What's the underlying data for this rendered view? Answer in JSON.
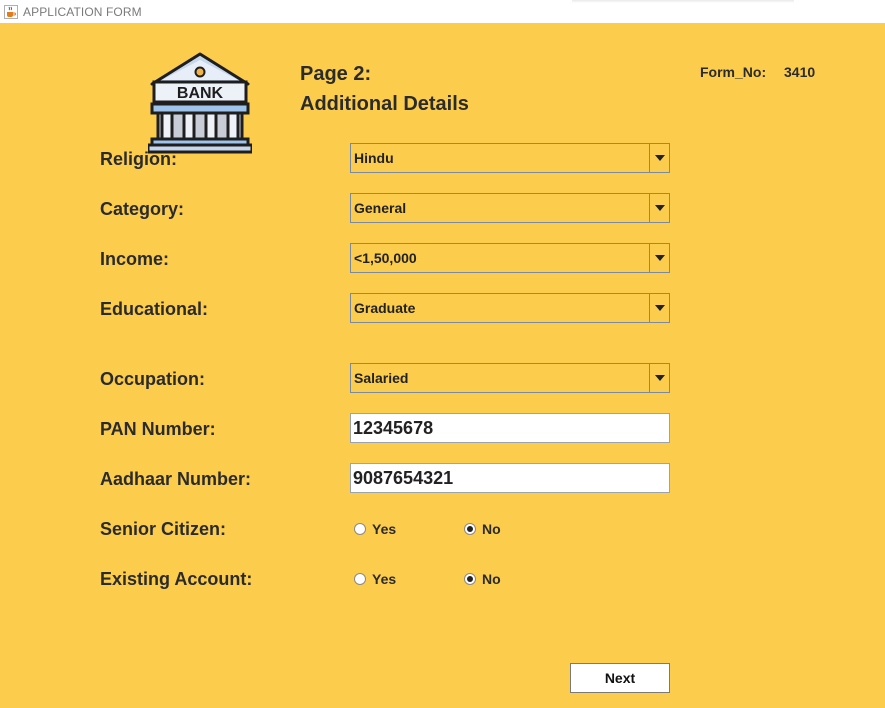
{
  "window": {
    "title": "APPLICATION FORM",
    "icon": "java-cup-icon"
  },
  "header": {
    "logo_text": "BANK",
    "page": "Page 2:",
    "subtitle": "Additional Details",
    "form_no_label": "Form_No:",
    "form_no_value": "3410"
  },
  "fields": {
    "religion": {
      "label": "Religion:",
      "value": "Hindu"
    },
    "category": {
      "label": "Category:",
      "value": "General"
    },
    "income": {
      "label": "Income:",
      "value": "<1,50,000"
    },
    "education": {
      "label": "Educational:",
      "value": "Graduate"
    },
    "occupation": {
      "label": "Occupation:",
      "value": "Salaried"
    },
    "pan": {
      "label": "PAN Number:",
      "value": "12345678"
    },
    "aadhaar": {
      "label": "Aadhaar Number:",
      "value": "9087654321"
    },
    "senior_citizen": {
      "label": "Senior Citizen:",
      "yes": "Yes",
      "no": "No",
      "selected": "No"
    },
    "existing_account": {
      "label": "Existing Account:",
      "yes": "Yes",
      "no": "No",
      "selected": "No"
    }
  },
  "actions": {
    "next_label": "Next"
  }
}
